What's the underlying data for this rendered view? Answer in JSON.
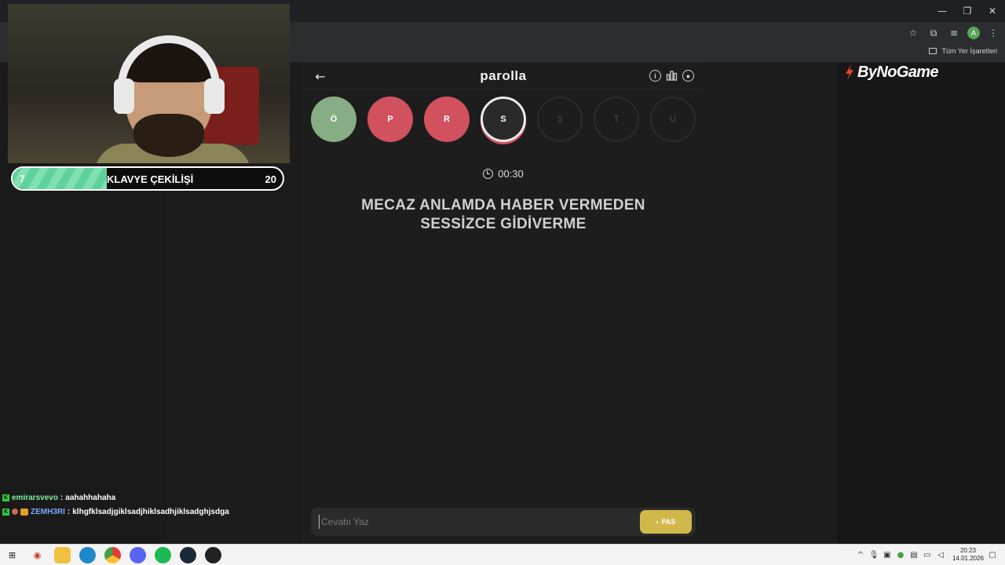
{
  "browser": {
    "bookmarks_all_label": "Tüm Yer İşaretleri",
    "profile_initial": "A"
  },
  "game": {
    "title": "parolla",
    "letters": [
      {
        "letter": "Ö",
        "state": "correct"
      },
      {
        "letter": "P",
        "state": "wrong"
      },
      {
        "letter": "R",
        "state": "wrong"
      },
      {
        "letter": "S",
        "state": "current"
      },
      {
        "letter": "Ş",
        "state": "pending"
      },
      {
        "letter": "T",
        "state": "pending"
      },
      {
        "letter": "U",
        "state": "pending"
      }
    ],
    "timer": "00:30",
    "question_line1": "MECAZ ANLAMDA HABER VERMEDEN",
    "question_line2": "SESSİZCE GİDİVERME",
    "answer_placeholder": "Cevabı Yaz",
    "pass_label": "PAS"
  },
  "stream": {
    "progress": {
      "current": "7",
      "label": "KLAVYE ÇEKİLİŞİ",
      "max": "20",
      "fraction": 0.35
    },
    "chat": [
      {
        "user": "emirarsvevo",
        "sep": " : ",
        "message": "aahahhahaha"
      },
      {
        "user": "ZEMH3RI",
        "sep": " : ",
        "message": "klhgfklsadjgiklsadjhiklsadhjiklsadghjsdga"
      }
    ],
    "logo_text": "ByNoGame"
  },
  "taskbar": {
    "time": "20:23",
    "date": "14.01.2026"
  },
  "colors": {
    "correct": "#86ad84",
    "wrong": "#d1515f",
    "pass": "#d1b84a",
    "progress": "#5fd19a"
  }
}
